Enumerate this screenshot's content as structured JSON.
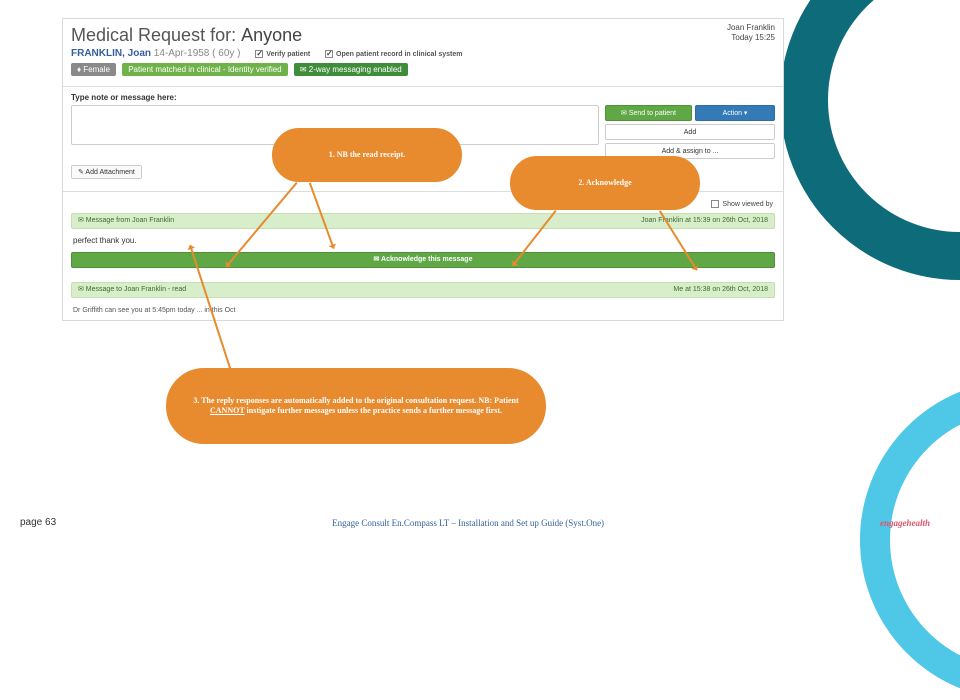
{
  "decor": {
    "arc_teal_name": "teal-arc",
    "arc_blue_name": "blue-arc"
  },
  "screenshot": {
    "title_prefix": "Medical Request for: ",
    "title_name": "Anyone",
    "user": {
      "name": "Joan Franklin",
      "time": "Today 15:25"
    },
    "patient": {
      "name_last": "FRANKLIN, Joan",
      "dob_age": "14-Apr-1958 ( 60y )",
      "verify": "Verify patient",
      "open_record": "Open patient record in clinical system"
    },
    "badges": {
      "sex": "♦ Female",
      "matched": "Patient matched in clinical - Identity verified",
      "twoway": "✉ 2-way messaging enabled"
    },
    "compose": {
      "label": "Type note or message here:",
      "send": "✉ Send to patient",
      "add": "Add",
      "assign": "Add & assign to ...",
      "action": "Action ▾",
      "attach": "✎ Add Attachment"
    },
    "viewedby": "Show viewed by",
    "thread": {
      "from_header_left": "✉  Message from Joan Franklin",
      "from_header_right": "Joan Franklin at 15:39 on 26th Oct, 2018",
      "body": "perfect thank you.",
      "ack_button": "✉ Acknowledge this message",
      "to_header_left": "✉  Message to Joan Franklin - read",
      "to_header_right": "Me at 15:38 on 26th Oct, 2018",
      "trail_partial": "Dr Griffith can see you at 5:45pm today ... in this Oct"
    }
  },
  "callouts": {
    "c1": "1. NB the read receipt.",
    "c2": "2. Acknowledge",
    "c3_pre": "3. The reply responses are automatically added to the original consultation request. NB: Patient ",
    "c3_strong": "CANNOT",
    "c3_post": " instigate further messages unless the practice sends a further message first."
  },
  "footer": {
    "page": "page 63",
    "doc": "Engage Consult  En.Compass LT – Installation and Set up Guide (Syst.One)",
    "brand": "engagehealth"
  }
}
